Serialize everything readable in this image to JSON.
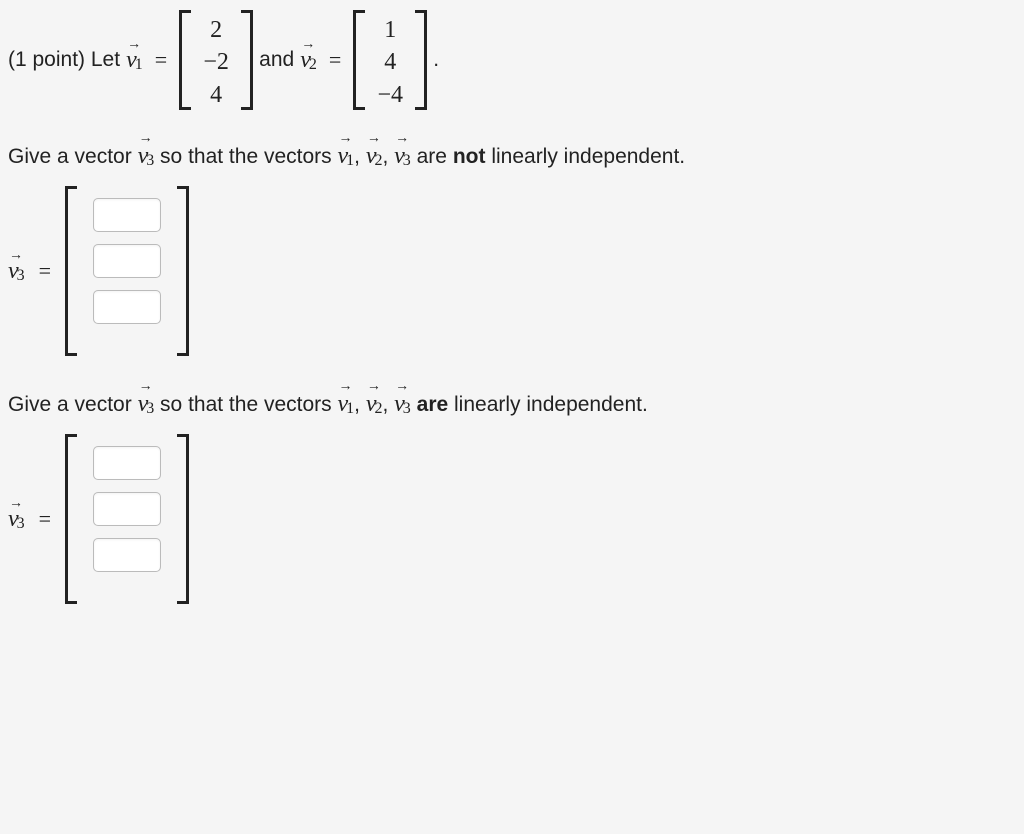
{
  "line1": {
    "prefix": "(1 point) Let ",
    "v1_label": "v",
    "v1_sub": "1",
    "eq": "=",
    "v1_values": [
      "2",
      "−2",
      "4"
    ],
    "and": " and ",
    "v2_label": "v",
    "v2_sub": "2",
    "v2_values": [
      "1",
      "4",
      "−4"
    ],
    "period": "."
  },
  "q1": {
    "pre": "Give a vector ",
    "v3_label": "v",
    "v3_sub": "3",
    "mid1": " so that the vectors ",
    "list_v1": "v",
    "list_v1s": "1",
    "comma1": ", ",
    "list_v2": "v",
    "list_v2s": "2",
    "comma2": ", ",
    "list_v3": "v",
    "list_v3s": "3",
    "mid2": " are ",
    "emph": "not",
    "tail": " linearly independent."
  },
  "q2": {
    "pre": "Give a vector ",
    "v3_label": "v",
    "v3_sub": "3",
    "mid1": " so that the vectors ",
    "list_v1": "v",
    "list_v1s": "1",
    "comma1": ", ",
    "list_v2": "v",
    "list_v2s": "2",
    "comma2": ", ",
    "list_v3": "v",
    "list_v3s": "3",
    "mid2": " ",
    "emph": "are",
    "tail": " linearly independent."
  },
  "answer": {
    "v3_label": "v",
    "v3_sub": "3",
    "eq": "="
  }
}
